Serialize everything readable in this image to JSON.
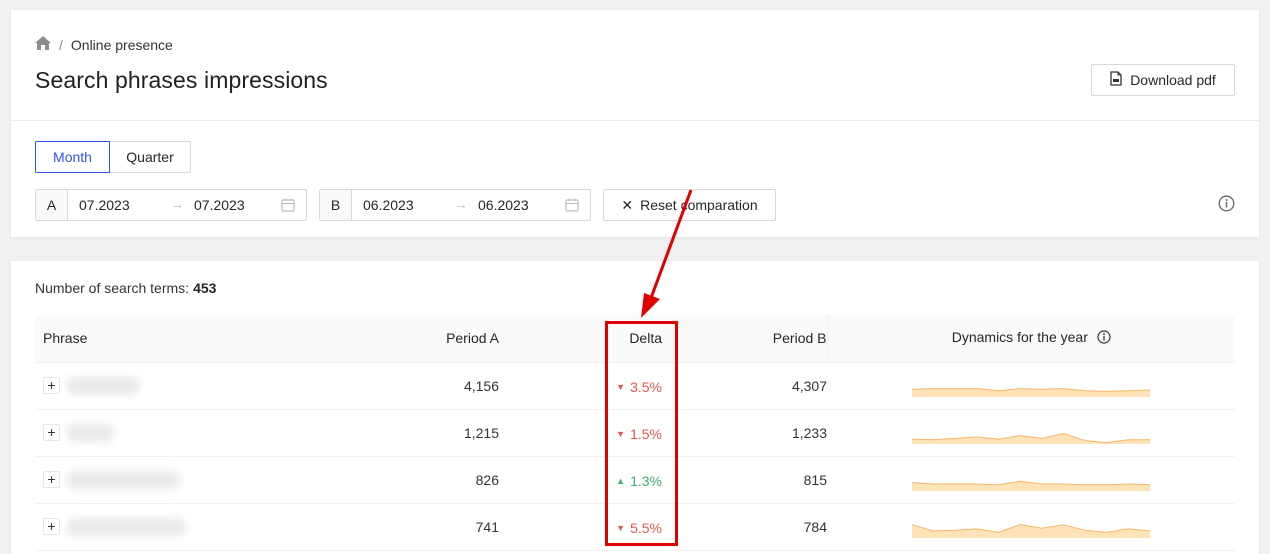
{
  "breadcrumb": {
    "current": "Online presence"
  },
  "header": {
    "title": "Search phrases impressions",
    "download_label": "Download pdf"
  },
  "period_toggle": {
    "month": "Month",
    "quarter": "Quarter",
    "selected": "Month"
  },
  "range_a": {
    "tag": "A",
    "from": "07.2023",
    "to": "07.2023"
  },
  "range_b": {
    "tag": "B",
    "from": "06.2023",
    "to": "06.2023"
  },
  "reset_label": "Reset comparation",
  "summary": {
    "label": "Number of search terms:",
    "count": "453"
  },
  "table": {
    "headers": {
      "phrase": "Phrase",
      "period_a": "Period A",
      "delta": "Delta",
      "period_b": "Period B",
      "dynamics": "Dynamics for the year"
    },
    "rows": [
      {
        "period_a": "4,156",
        "delta": "3.5%",
        "direction": "down",
        "period_b": "4,307",
        "spark": [
          0.55,
          0.6,
          0.6,
          0.6,
          0.45,
          0.6,
          0.55,
          0.6,
          0.45,
          0.4,
          0.45,
          0.5
        ]
      },
      {
        "period_a": "1,215",
        "delta": "1.5%",
        "direction": "down",
        "period_b": "1,233",
        "spark": [
          0.35,
          0.3,
          0.4,
          0.5,
          0.35,
          0.6,
          0.4,
          0.75,
          0.25,
          0.1,
          0.3,
          0.3
        ]
      },
      {
        "period_a": "826",
        "delta": "1.3%",
        "direction": "up",
        "period_b": "815",
        "spark": [
          0.6,
          0.5,
          0.5,
          0.5,
          0.45,
          0.7,
          0.5,
          0.5,
          0.45,
          0.45,
          0.5,
          0.45
        ]
      },
      {
        "period_a": "741",
        "delta": "5.5%",
        "direction": "down",
        "period_b": "784",
        "spark": [
          0.95,
          0.5,
          0.55,
          0.65,
          0.4,
          0.95,
          0.7,
          0.95,
          0.55,
          0.4,
          0.65,
          0.5
        ]
      }
    ]
  },
  "colors": {
    "accent": "#2f54eb",
    "down": "#e2574c",
    "up": "#3fae70",
    "spark_fill": "#ffe3b8",
    "spark_line": "#f5b66a",
    "highlight": "#e00000"
  }
}
